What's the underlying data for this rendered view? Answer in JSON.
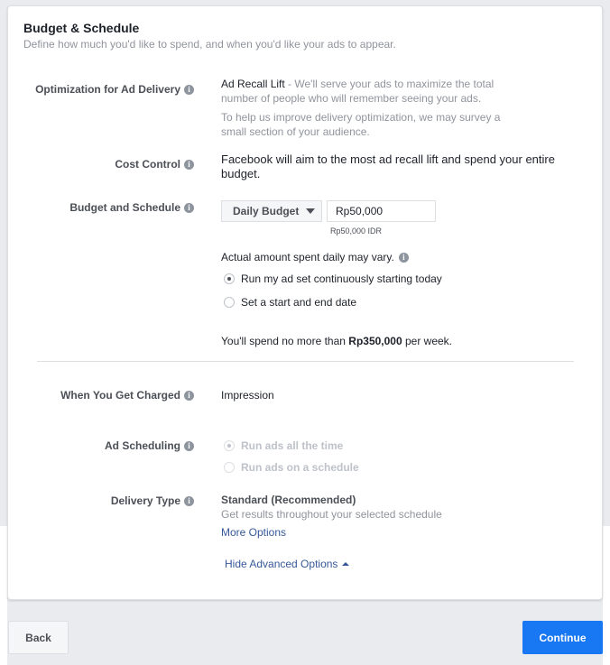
{
  "header": {
    "title": "Budget & Schedule",
    "subtitle": "Define how much you'd like to spend, and when you'd like your ads to appear."
  },
  "optimization": {
    "label": "Optimization for Ad Delivery",
    "value": "Ad Recall Lift",
    "desc": " - We'll serve your ads to maximize the total number of people who will remember seeing your ads.",
    "note": "To help us improve delivery optimization, we may survey a small section of your audience."
  },
  "cost_control": {
    "label": "Cost Control",
    "value": "Facebook will aim to the most ad recall lift and spend your entire budget."
  },
  "budget": {
    "label": "Budget and Schedule",
    "type": "Daily Budget",
    "amount": "Rp50,000",
    "amount_hint": "Rp50,000 IDR",
    "vary_note": "Actual amount spent daily may vary.",
    "options": [
      {
        "label": "Run my ad set continuously starting today",
        "selected": true
      },
      {
        "label": "Set a start and end date",
        "selected": false
      }
    ],
    "weekly_prefix": "You'll spend no more than ",
    "weekly_amount": "Rp350,000",
    "weekly_suffix": " per week."
  },
  "charged": {
    "label": "When You Get Charged",
    "value": "Impression"
  },
  "scheduling": {
    "label": "Ad Scheduling",
    "options": [
      {
        "label": "Run ads all the time",
        "selected": true,
        "disabled": true
      },
      {
        "label": "Run ads on a schedule",
        "selected": false,
        "disabled": true
      }
    ]
  },
  "delivery": {
    "label": "Delivery Type",
    "value": "Standard (Recommended)",
    "desc": "Get results throughout your selected schedule",
    "more": "More Options"
  },
  "advanced": {
    "label": "Hide Advanced Options"
  },
  "footer": {
    "back": "Back",
    "continue": "Continue"
  },
  "colors": {
    "primary": "#1877f2",
    "link": "#365899"
  }
}
